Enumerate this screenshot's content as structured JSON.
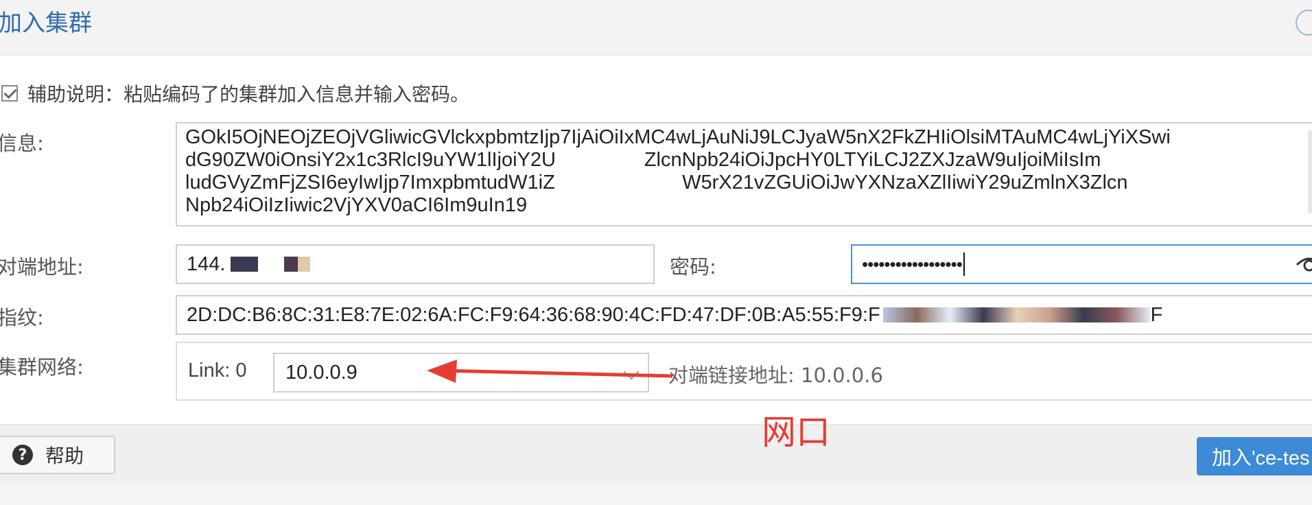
{
  "dialog": {
    "title": "加入集群",
    "assist_text": "辅助说明：粘贴编码了的集群加入信息并输入密码。",
    "info_label": "信息:",
    "info_lines": [
      "GOkI5OjNEOjZEOjVGliwicGVlckxpbmtzIjp7IjAiOiIxMC4wLjAuNiJ9LCJyaW5nX2FkZHIiOlsiMTAuMC4wLjYiXSwi",
      "dG90ZW0iOnsiY2x1c3RlcI9uYW1lIjoiY2U                ZlcnNpb24iOiJpcHY0LTYiLCJ2ZXJzaW9uIjoiMiIsIm",
      "ludGVyZmFjZSI6eyIwIjp7ImxpbmtudW1iZ                       W5rX21vZGUiOiJwYXNzaXZlIiwiY29uZmlnX3Zlcn",
      "Npb24iOiIzIiwic2VjYXV0aCI6Im9uIn19"
    ],
    "peer_addr_label": "对端地址:",
    "peer_addr_value": "144.",
    "password_label": "密码:",
    "password_value": "••••••••••••••••••",
    "fingerprint_label": "指纹:",
    "fingerprint_value": "2D:DC:B6:8C:31:E8:7E:02:6A:FC:F9:64:36:68:90:4C:FD:47:DF:0B:A5:55:F9:F",
    "fingerprint_tail": "F",
    "cluster_network_label": "集群网络:",
    "link_label": "Link:",
    "link_number": "0",
    "link_value": "10.0.0.9",
    "peer_link_label": "对端链接地址: 10.0.0.6",
    "annotation": "网口",
    "help_button": "帮助",
    "join_button": "加入'ce-tes"
  },
  "colors": {
    "accent": "#3d8bd6",
    "annotation": "#e53d34",
    "title": "#2f6db0"
  }
}
